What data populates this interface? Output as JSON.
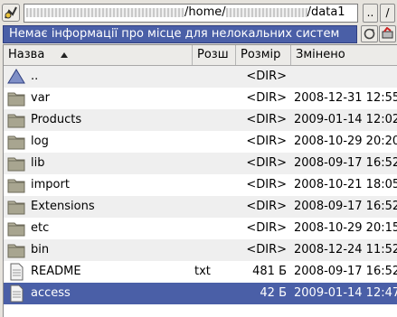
{
  "toolbar": {
    "path_prefix": "",
    "path_mid": "/home/",
    "path_suffix": "/data1",
    "up_label": "..",
    "root_label": "/"
  },
  "status": {
    "text": "Немає інформації про місце для нелокальних систем"
  },
  "columns": {
    "name": "Назва",
    "ext": "Розш",
    "size": "Розмір",
    "modified": "Змінено"
  },
  "files": [
    {
      "icon": "up-triangle-icon",
      "name": "..",
      "ext": "",
      "size": "<DIR>",
      "modified": ""
    },
    {
      "icon": "folder-icon",
      "name": "var",
      "ext": "",
      "size": "<DIR>",
      "modified": "2008-12-31 12:55"
    },
    {
      "icon": "folder-icon",
      "name": "Products",
      "ext": "",
      "size": "<DIR>",
      "modified": "2009-01-14 12:02"
    },
    {
      "icon": "folder-icon",
      "name": "log",
      "ext": "",
      "size": "<DIR>",
      "modified": "2008-10-29 20:20"
    },
    {
      "icon": "folder-icon",
      "name": "lib",
      "ext": "",
      "size": "<DIR>",
      "modified": "2008-09-17 16:52"
    },
    {
      "icon": "folder-icon",
      "name": "import",
      "ext": "",
      "size": "<DIR>",
      "modified": "2008-10-21 18:05"
    },
    {
      "icon": "folder-icon",
      "name": "Extensions",
      "ext": "",
      "size": "<DIR>",
      "modified": "2008-09-17 16:52"
    },
    {
      "icon": "folder-icon",
      "name": "etc",
      "ext": "",
      "size": "<DIR>",
      "modified": "2008-10-29 20:15"
    },
    {
      "icon": "folder-icon",
      "name": "bin",
      "ext": "",
      "size": "<DIR>",
      "modified": "2008-12-24 11:52"
    },
    {
      "icon": "document-icon",
      "name": "README",
      "ext": "txt",
      "size": "481 Б",
      "modified": "2008-09-17 16:52"
    },
    {
      "icon": "document-icon",
      "name": "access",
      "ext": "",
      "size": "42 Б",
      "modified": "2009-01-14 12:47"
    }
  ],
  "selected_index": 10,
  "colors": {
    "accent": "#4a5fa7",
    "folder": "#a8a590"
  }
}
